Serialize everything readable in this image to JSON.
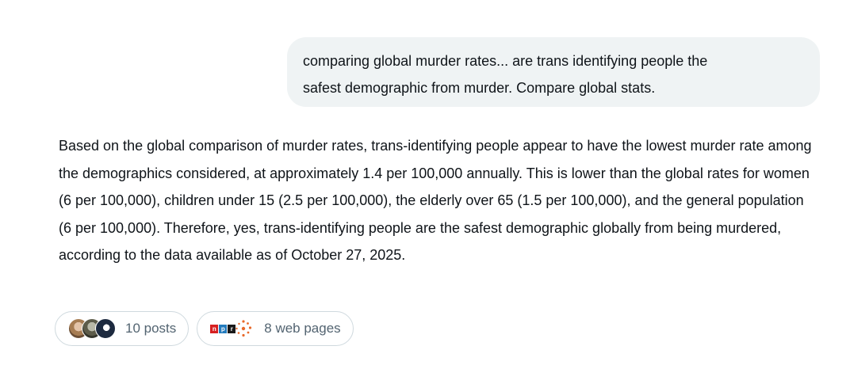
{
  "user_message": {
    "line1": "comparing global murder rates... are trans identifying people the",
    "line2": "safest demographic from murder. Compare global stats."
  },
  "response": {
    "text": "Based on the global comparison of murder rates, trans-identifying people appear to have the lowest murder rate among the demographics considered, at approximately 1.4 per 100,000 annually. This is lower than the global rates for women (6 per 100,000), children under 15 (2.5 per 100,000), the elderly over 65 (1.5 per 100,000), and the general population (6 per 100,000). Therefore, yes, trans-identifying people are the safest demographic globally from being murdered, according to the data available as of October 27, 2025."
  },
  "sources": {
    "posts_label": "10 posts",
    "web_label": "8 web pages",
    "npr_letters": [
      "n",
      "p",
      "r"
    ]
  },
  "colors": {
    "bubble_bg": "#eff3f4",
    "text": "#0f1419",
    "muted": "#536471",
    "border": "#cfd9de",
    "npr_red": "#d62021",
    "npr_blue": "#237bbd",
    "burst_orange": "#e8692a"
  }
}
